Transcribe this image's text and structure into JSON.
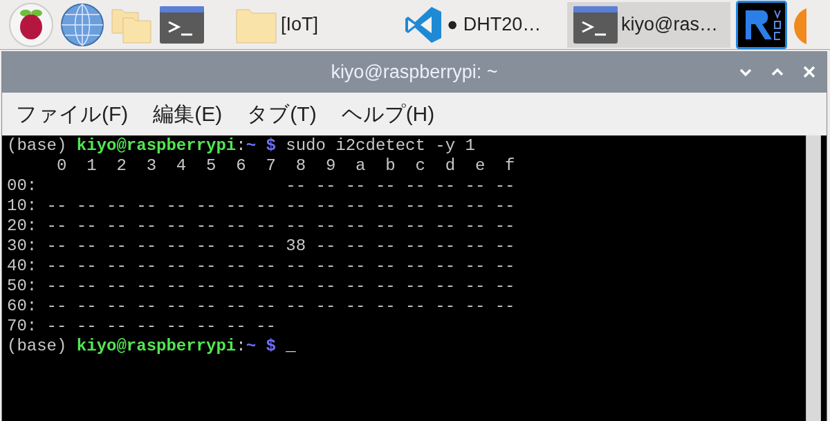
{
  "taskbar": {
    "tasks": [
      {
        "kind": "folder",
        "label": "[IoT]",
        "selected": false
      },
      {
        "kind": "editor",
        "label": "● DHT20…",
        "selected": false
      },
      {
        "kind": "terminal",
        "label": "kiyo@ras…",
        "selected": true
      }
    ]
  },
  "window": {
    "title": "kiyo@raspberrypi: ~",
    "menu": [
      "ファイル(F)",
      "編集(E)",
      "タブ(T)",
      "ヘルプ(H)"
    ],
    "terminal": {
      "lines": [
        [
          {
            "kind": "plain",
            "text": "(base) "
          },
          {
            "kind": "user",
            "text": "kiyo@raspberrypi"
          },
          {
            "kind": "plain",
            "text": ":"
          },
          {
            "kind": "path",
            "text": "~ $"
          },
          {
            "kind": "plain",
            "text": " sudo i2cdetect -y 1"
          }
        ],
        [
          {
            "kind": "plain",
            "text": "     0  1  2  3  4  5  6  7  8  9  a  b  c  d  e  f"
          }
        ],
        [
          {
            "kind": "plain",
            "text": "00:                         -- -- -- -- -- -- -- --"
          }
        ],
        [
          {
            "kind": "plain",
            "text": "10: -- -- -- -- -- -- -- -- -- -- -- -- -- -- -- --"
          }
        ],
        [
          {
            "kind": "plain",
            "text": "20: -- -- -- -- -- -- -- -- -- -- -- -- -- -- -- --"
          }
        ],
        [
          {
            "kind": "plain",
            "text": "30: -- -- -- -- -- -- -- -- 38 -- -- -- -- -- -- --"
          }
        ],
        [
          {
            "kind": "plain",
            "text": "40: -- -- -- -- -- -- -- -- -- -- -- -- -- -- -- --"
          }
        ],
        [
          {
            "kind": "plain",
            "text": "50: -- -- -- -- -- -- -- -- -- -- -- -- -- -- -- --"
          }
        ],
        [
          {
            "kind": "plain",
            "text": "60: -- -- -- -- -- -- -- -- -- -- -- -- -- -- -- --"
          }
        ],
        [
          {
            "kind": "plain",
            "text": "70: -- -- -- -- -- -- -- --"
          }
        ],
        [
          {
            "kind": "plain",
            "text": "(base) "
          },
          {
            "kind": "user",
            "text": "kiyo@raspberrypi"
          },
          {
            "kind": "plain",
            "text": ":"
          },
          {
            "kind": "path",
            "text": "~ $"
          },
          {
            "kind": "cursor",
            "text": "_"
          }
        ]
      ]
    }
  }
}
